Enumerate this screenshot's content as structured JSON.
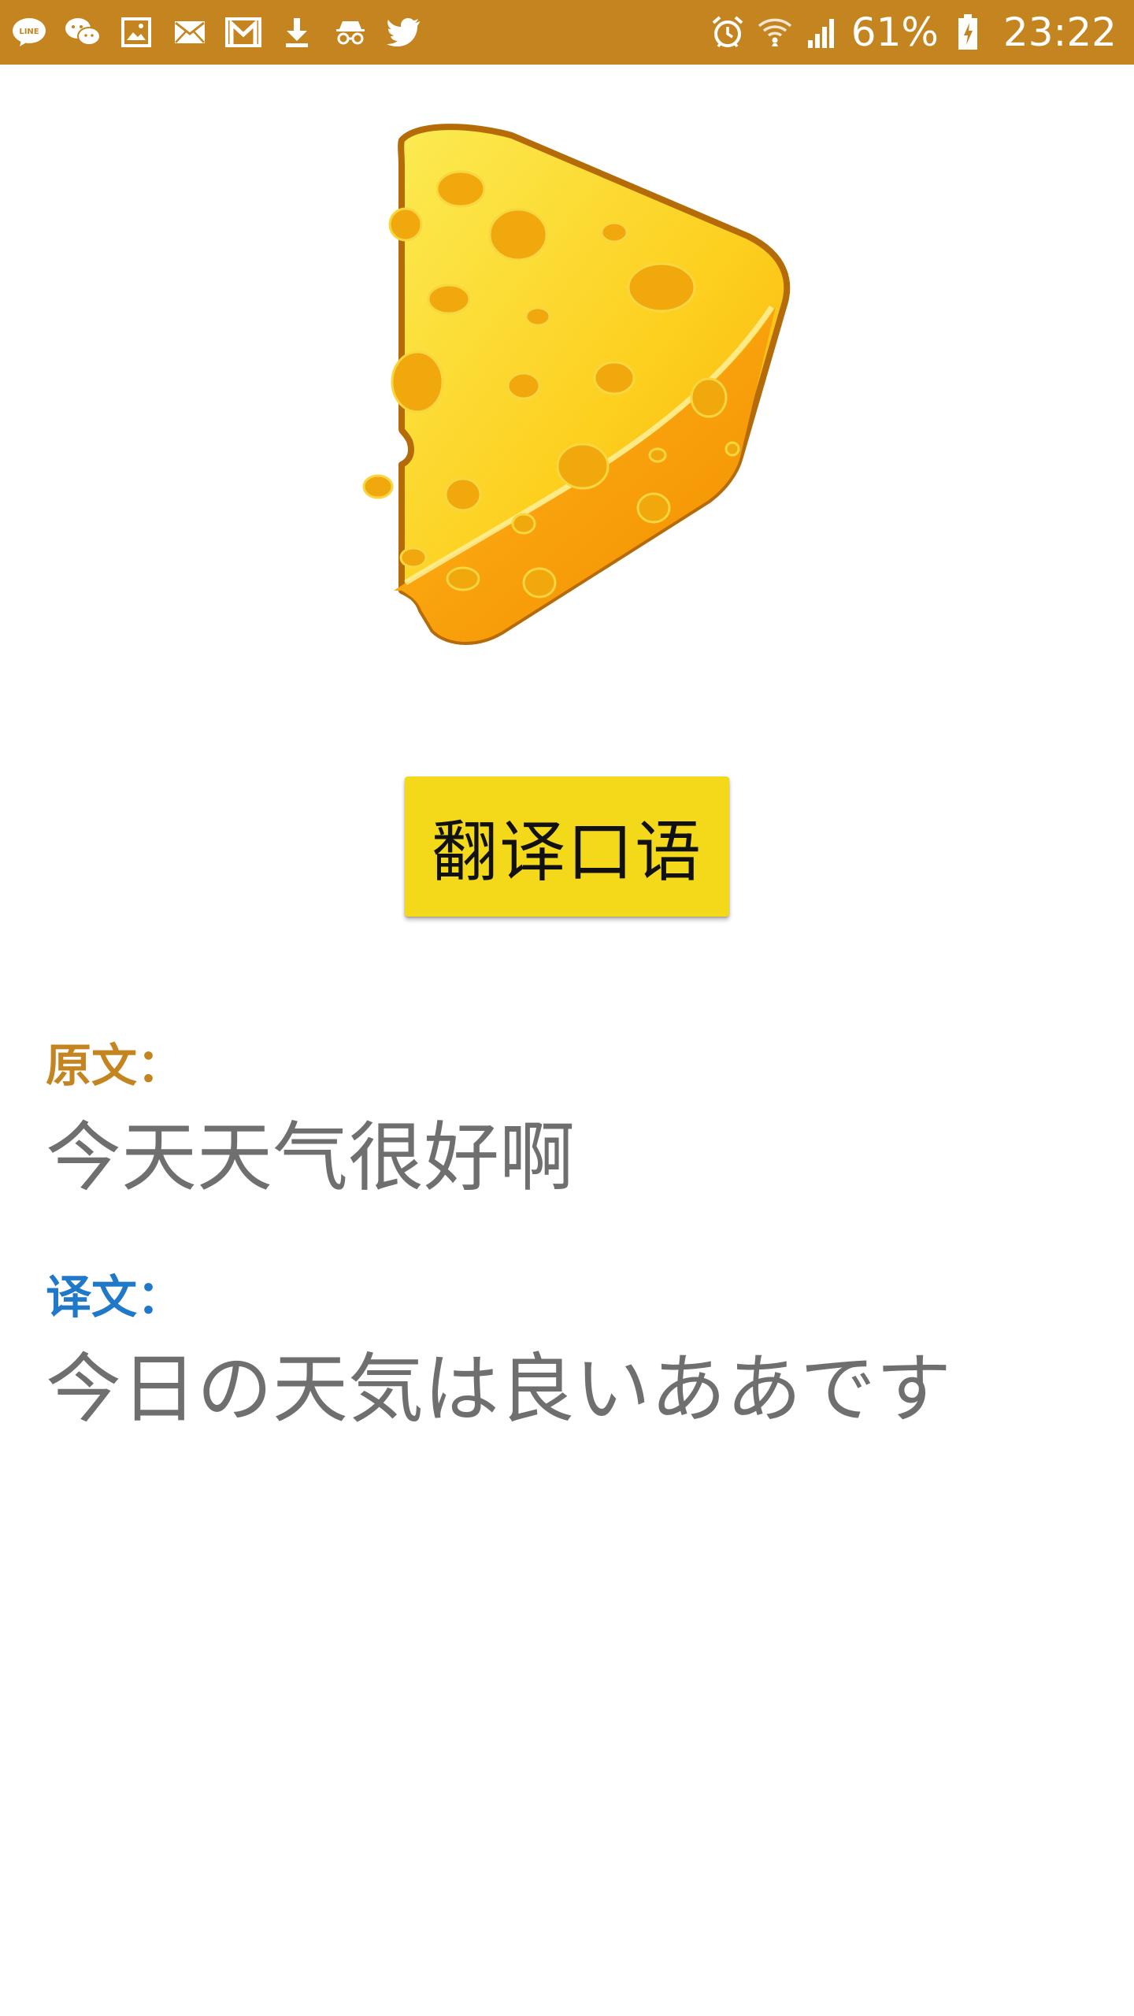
{
  "status_bar": {
    "left_icons": [
      "line-icon",
      "wechat-icon",
      "gallery-icon",
      "mail-icon",
      "gmail-icon",
      "download-icon",
      "incognito-icon",
      "twitter-icon"
    ],
    "right_icons": [
      "alarm-icon",
      "wifi-icon",
      "signal-icon",
      "battery-icon"
    ],
    "battery": "61%",
    "time": "23:22",
    "background_color": "#c4841f"
  },
  "logo": {
    "icon": "cheese-icon"
  },
  "translate_button": {
    "label": "翻译口语",
    "color": "#f4d91b"
  },
  "original": {
    "label": "原文：",
    "label_color": "#c4841f",
    "text": "今天天气很好啊"
  },
  "translated": {
    "label": "译文：",
    "label_color": "#1f78c8",
    "text": "今日の天気は良いああです"
  }
}
